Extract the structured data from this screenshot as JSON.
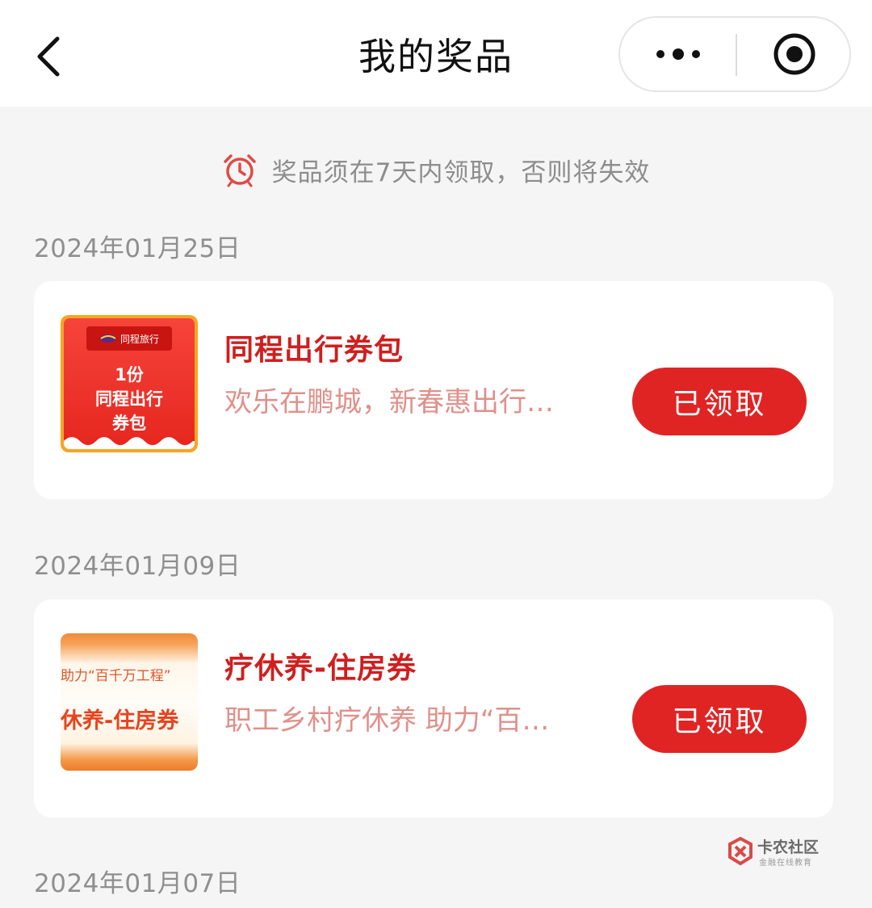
{
  "navbar": {
    "title": "我的奖品"
  },
  "notice": {
    "text": "奖品须在7天内领取，否则将失效",
    "icon": "alarm-clock-icon",
    "icon_color": "#e04a45"
  },
  "groups": [
    {
      "date": "2024年01月25日",
      "prize": {
        "name": "同程出行券包",
        "description": "欢乐在鹏城，新春惠出行…",
        "button_label": "已领取",
        "thumbnail": {
          "brand": "同程旅行",
          "lines": [
            "1份",
            "同程出行",
            "券包"
          ]
        }
      }
    },
    {
      "date": "2024年01月09日",
      "prize": {
        "name": "疗休养-住房券",
        "description": "职工乡村疗休养 助力“百…",
        "button_label": "已领取",
        "thumbnail": {
          "line1": "助力“百千万工程”",
          "line2": "休养-住房券"
        }
      }
    },
    {
      "date": "2024年01月07日"
    }
  ],
  "watermark": {
    "title": "卡农社区",
    "subtitle": "金融在线教育"
  },
  "colors": {
    "accent": "#e02424",
    "prize_name": "#cf1f1f",
    "prize_desc": "#e0908a",
    "background": "#f5f5f5"
  }
}
